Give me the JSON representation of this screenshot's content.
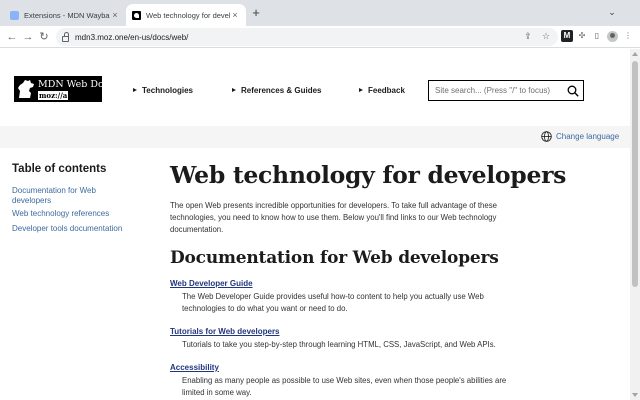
{
  "browser": {
    "tabs": [
      {
        "title": "Extensions - MDN Wayback",
        "active": false,
        "icon": "extensions-icon"
      },
      {
        "title": "Web technology for developers",
        "active": true,
        "icon": "mdn-favicon"
      }
    ],
    "new_tab_symbol": "+",
    "tab_menu_symbol": "⌄",
    "close_symbol": "×",
    "url": "mdn3.moz.one/en-us/docs/web/",
    "nav": {
      "back": "←",
      "forward": "→",
      "reload": "↻"
    },
    "url_actions": {
      "share": "⇪",
      "bookmark": "☆"
    },
    "extensions": {
      "ext1": "M",
      "puzzle": "✣",
      "sidepanel": "▯"
    },
    "menu_symbol": "⋮"
  },
  "site": {
    "logo": {
      "title": "MDN Web Docs",
      "subtitle": "moz://a"
    },
    "nav": [
      {
        "label": "Technologies"
      },
      {
        "label": "References & Guides"
      },
      {
        "label": "Feedback"
      }
    ],
    "search_placeholder": "Site search... (Press \"/\" to focus)",
    "change_language": "Change language"
  },
  "toc": {
    "title": "Table of contents",
    "links": [
      "Documentation for Web developers",
      "Web technology references",
      "Developer tools documentation"
    ]
  },
  "article": {
    "title": "Web technology for developers",
    "intro": "The open Web presents incredible opportunities for developers. To take full advantage of these technologies, you need to know how to use them. Below you'll find links to our Web technology documentation.",
    "section_title": "Documentation for Web developers",
    "entries": [
      {
        "term": "Web Developer Guide",
        "desc": "The Web Developer Guide provides useful how-to content to help you actually use Web technologies to do what you want or need to do."
      },
      {
        "term": "Tutorials for Web developers",
        "desc": "Tutorials to take you step-by-step through learning HTML, CSS, JavaScript, and Web APIs."
      },
      {
        "term": "Accessibility",
        "desc": "Enabling as many people as possible to use Web sites, even when those people's abilities are limited in some way."
      }
    ]
  },
  "colors": {
    "link": "#3d6a9e",
    "term_link": "#21367e",
    "chrome_bg": "#dee1e6",
    "lang_bar_bg": "#f5f5f5"
  }
}
